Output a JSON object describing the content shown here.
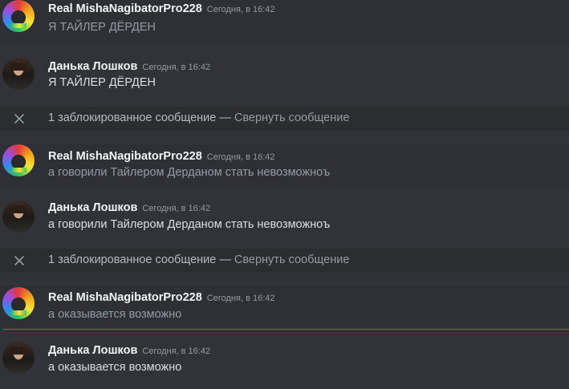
{
  "messages": [
    {
      "username": "Real MishaNagibatorPro228",
      "timestamp": "Сегодня, в 16:42",
      "text": "Я ТАЙЛЕР ДЁРДЕН",
      "avatar": "clown-avatar"
    },
    {
      "username": "Данька Лошков",
      "timestamp": "Сегодня, в 16:42",
      "text": "Я ТАЙЛЕР ДЁРДЕН",
      "avatar": "man-avatar"
    },
    {
      "username": "Real MishaNagibatorPro228",
      "timestamp": "Сегодня, в 16:42",
      "text": "а говорили Тайлером Дерданом стать невозможноъ",
      "avatar": "clown-avatar"
    },
    {
      "username": "Данька Лошков",
      "timestamp": "Сегодня, в 16:42",
      "text": "а говорили Тайлером Дерданом стать невозможноъ",
      "avatar": "man-avatar"
    },
    {
      "username": "Real MishaNagibatorPro228",
      "timestamp": "Сегодня, в 16:42",
      "text": "а оказывается возможно",
      "avatar": "clown-avatar"
    },
    {
      "username": "Данька Лошков",
      "timestamp": "Сегодня, в 16:42",
      "text": "а оказывается возможно",
      "avatar": "man-avatar"
    }
  ],
  "blocked_notice": {
    "text": "1 заблокированное сообщение — ",
    "collapse_label": "Свернуть сообщение",
    "icon": "close-icon"
  },
  "colors": {
    "background": "#313338",
    "blocked_bg": "#2b2d31",
    "new_messages_divider": "#d83a42"
  }
}
